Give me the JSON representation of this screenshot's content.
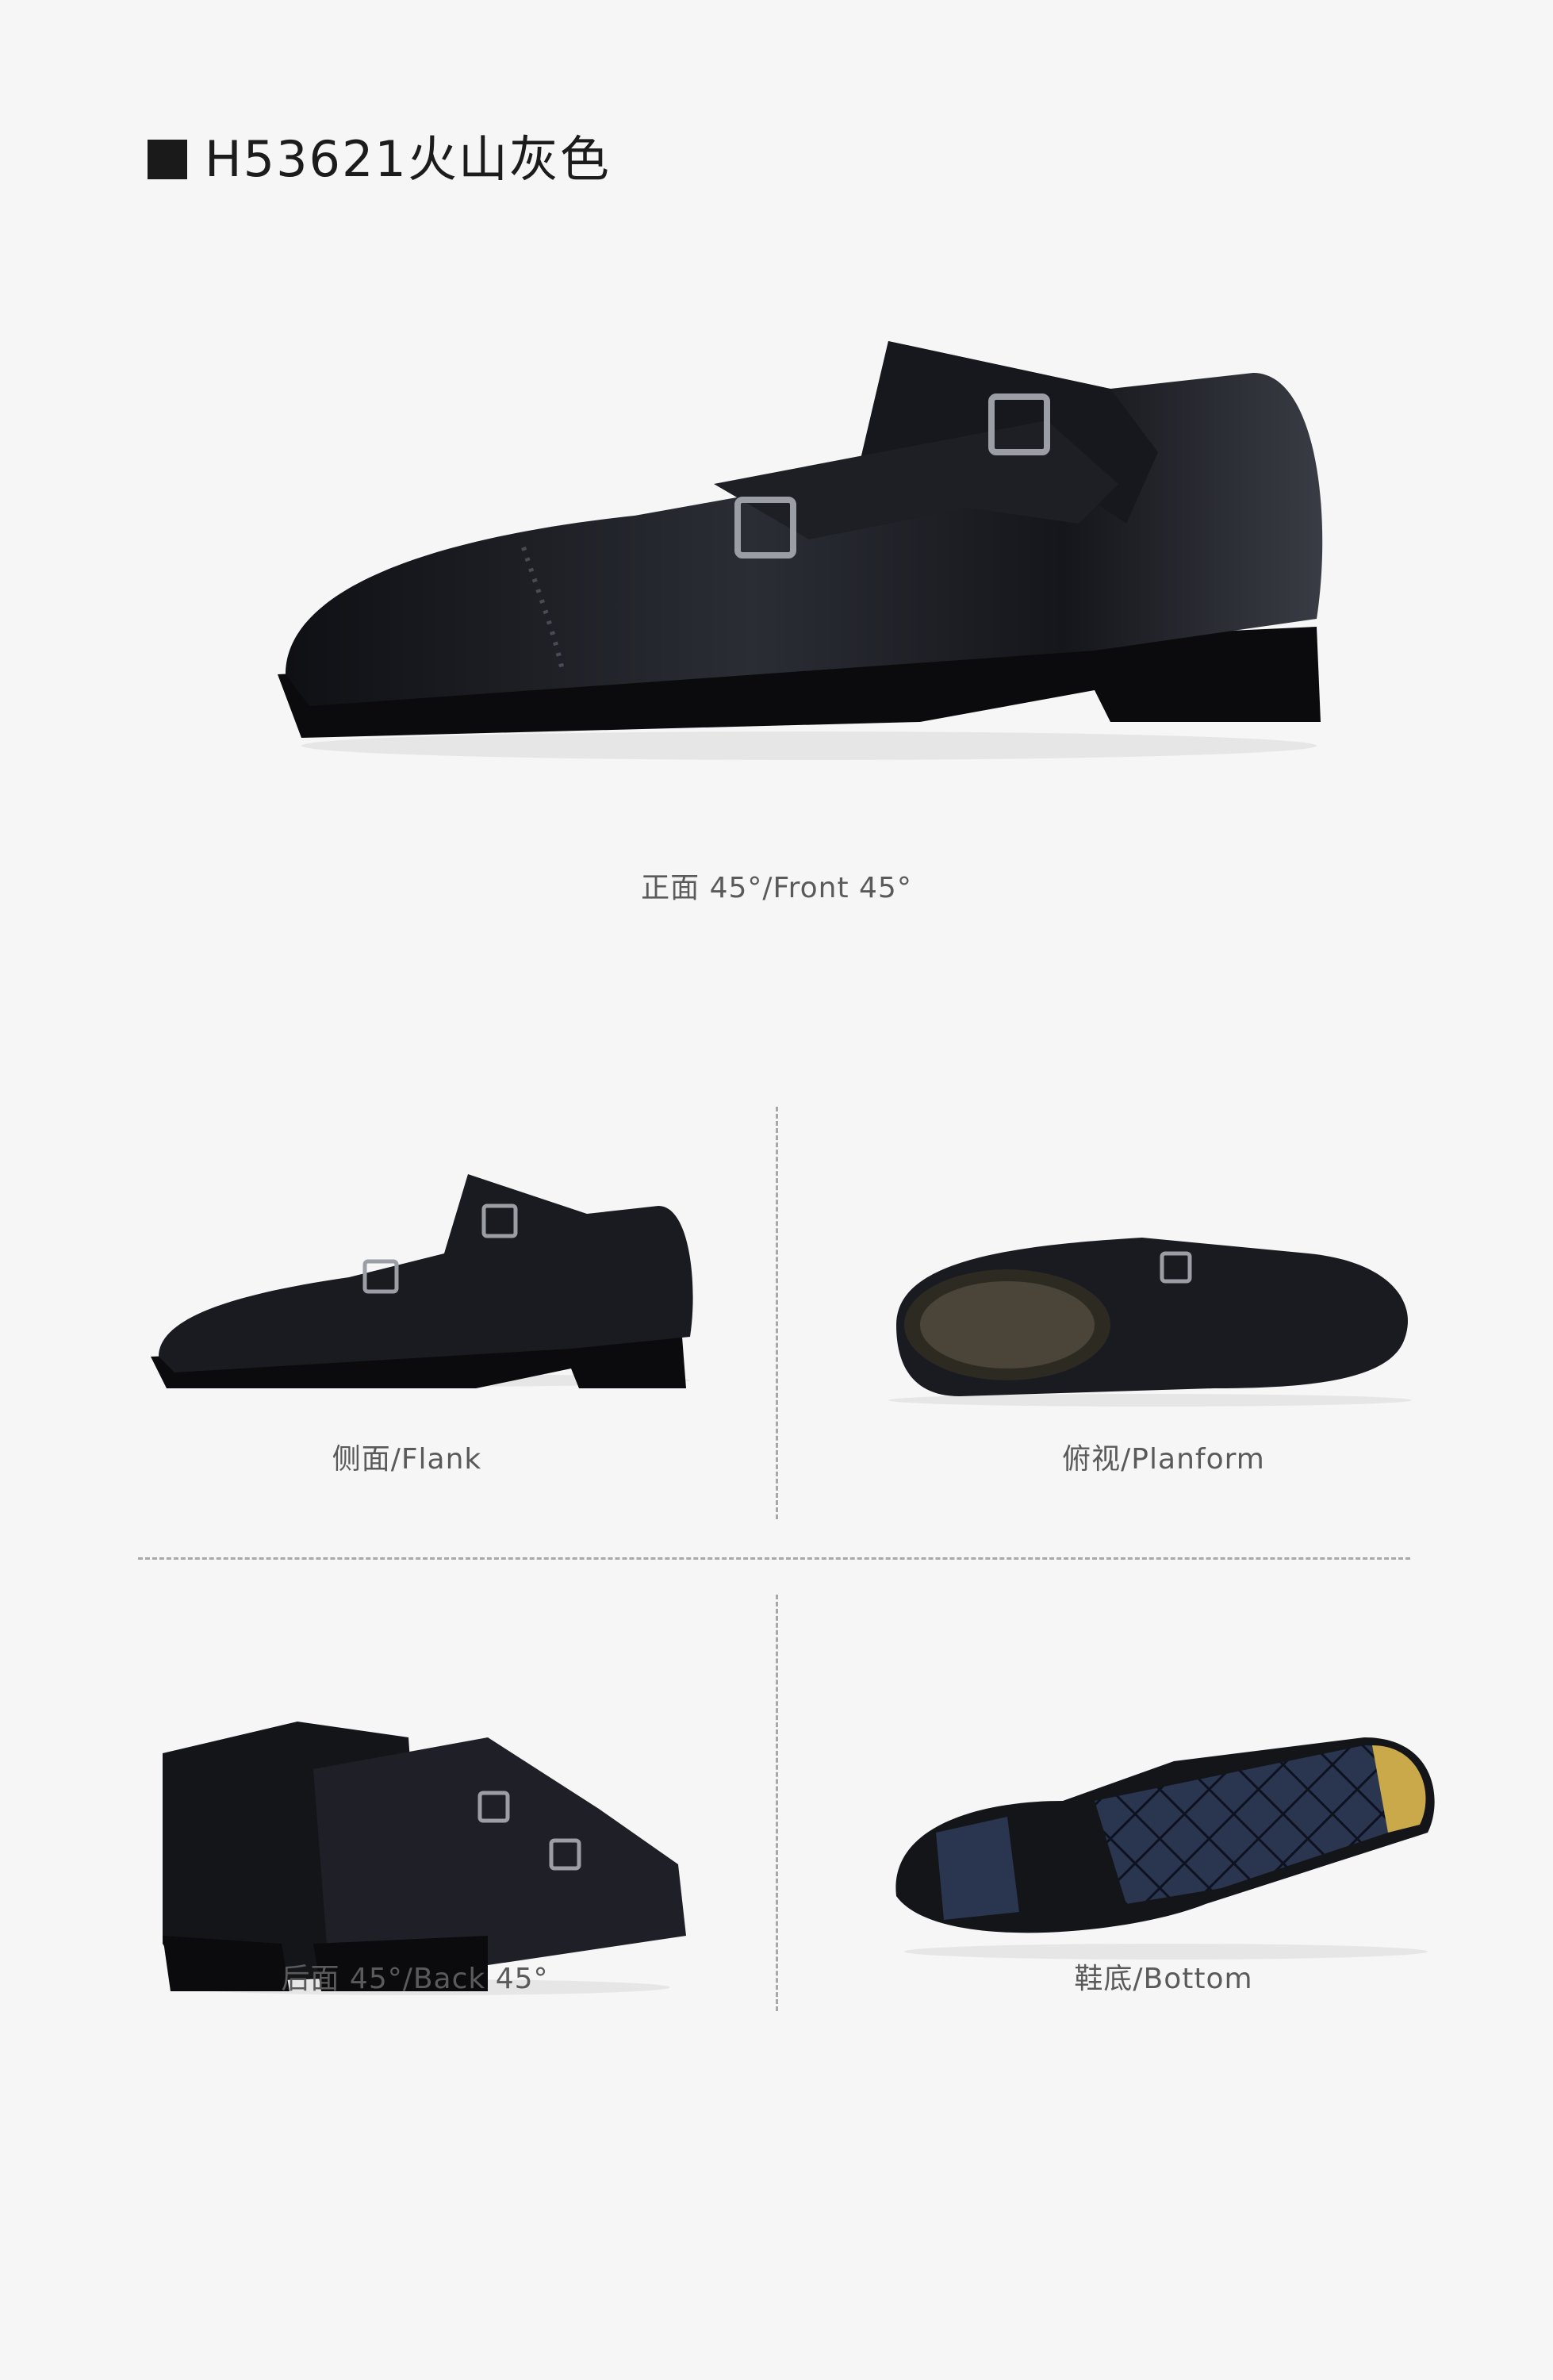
{
  "product": {
    "title": "H53621火山灰色"
  },
  "views": [
    {
      "label": "正面 45°/Front 45°"
    },
    {
      "label": "侧面/Flank"
    },
    {
      "label": "俯视/Planform"
    },
    {
      "label": "后面 45°/Back 45°"
    },
    {
      "label": "鞋底/Bottom"
    }
  ],
  "colors": {
    "background": "#f6f6f6",
    "leather": "#1b1c22",
    "outsole_blue": "#2a3550",
    "toe_plate_gold": "#c9a94a"
  }
}
